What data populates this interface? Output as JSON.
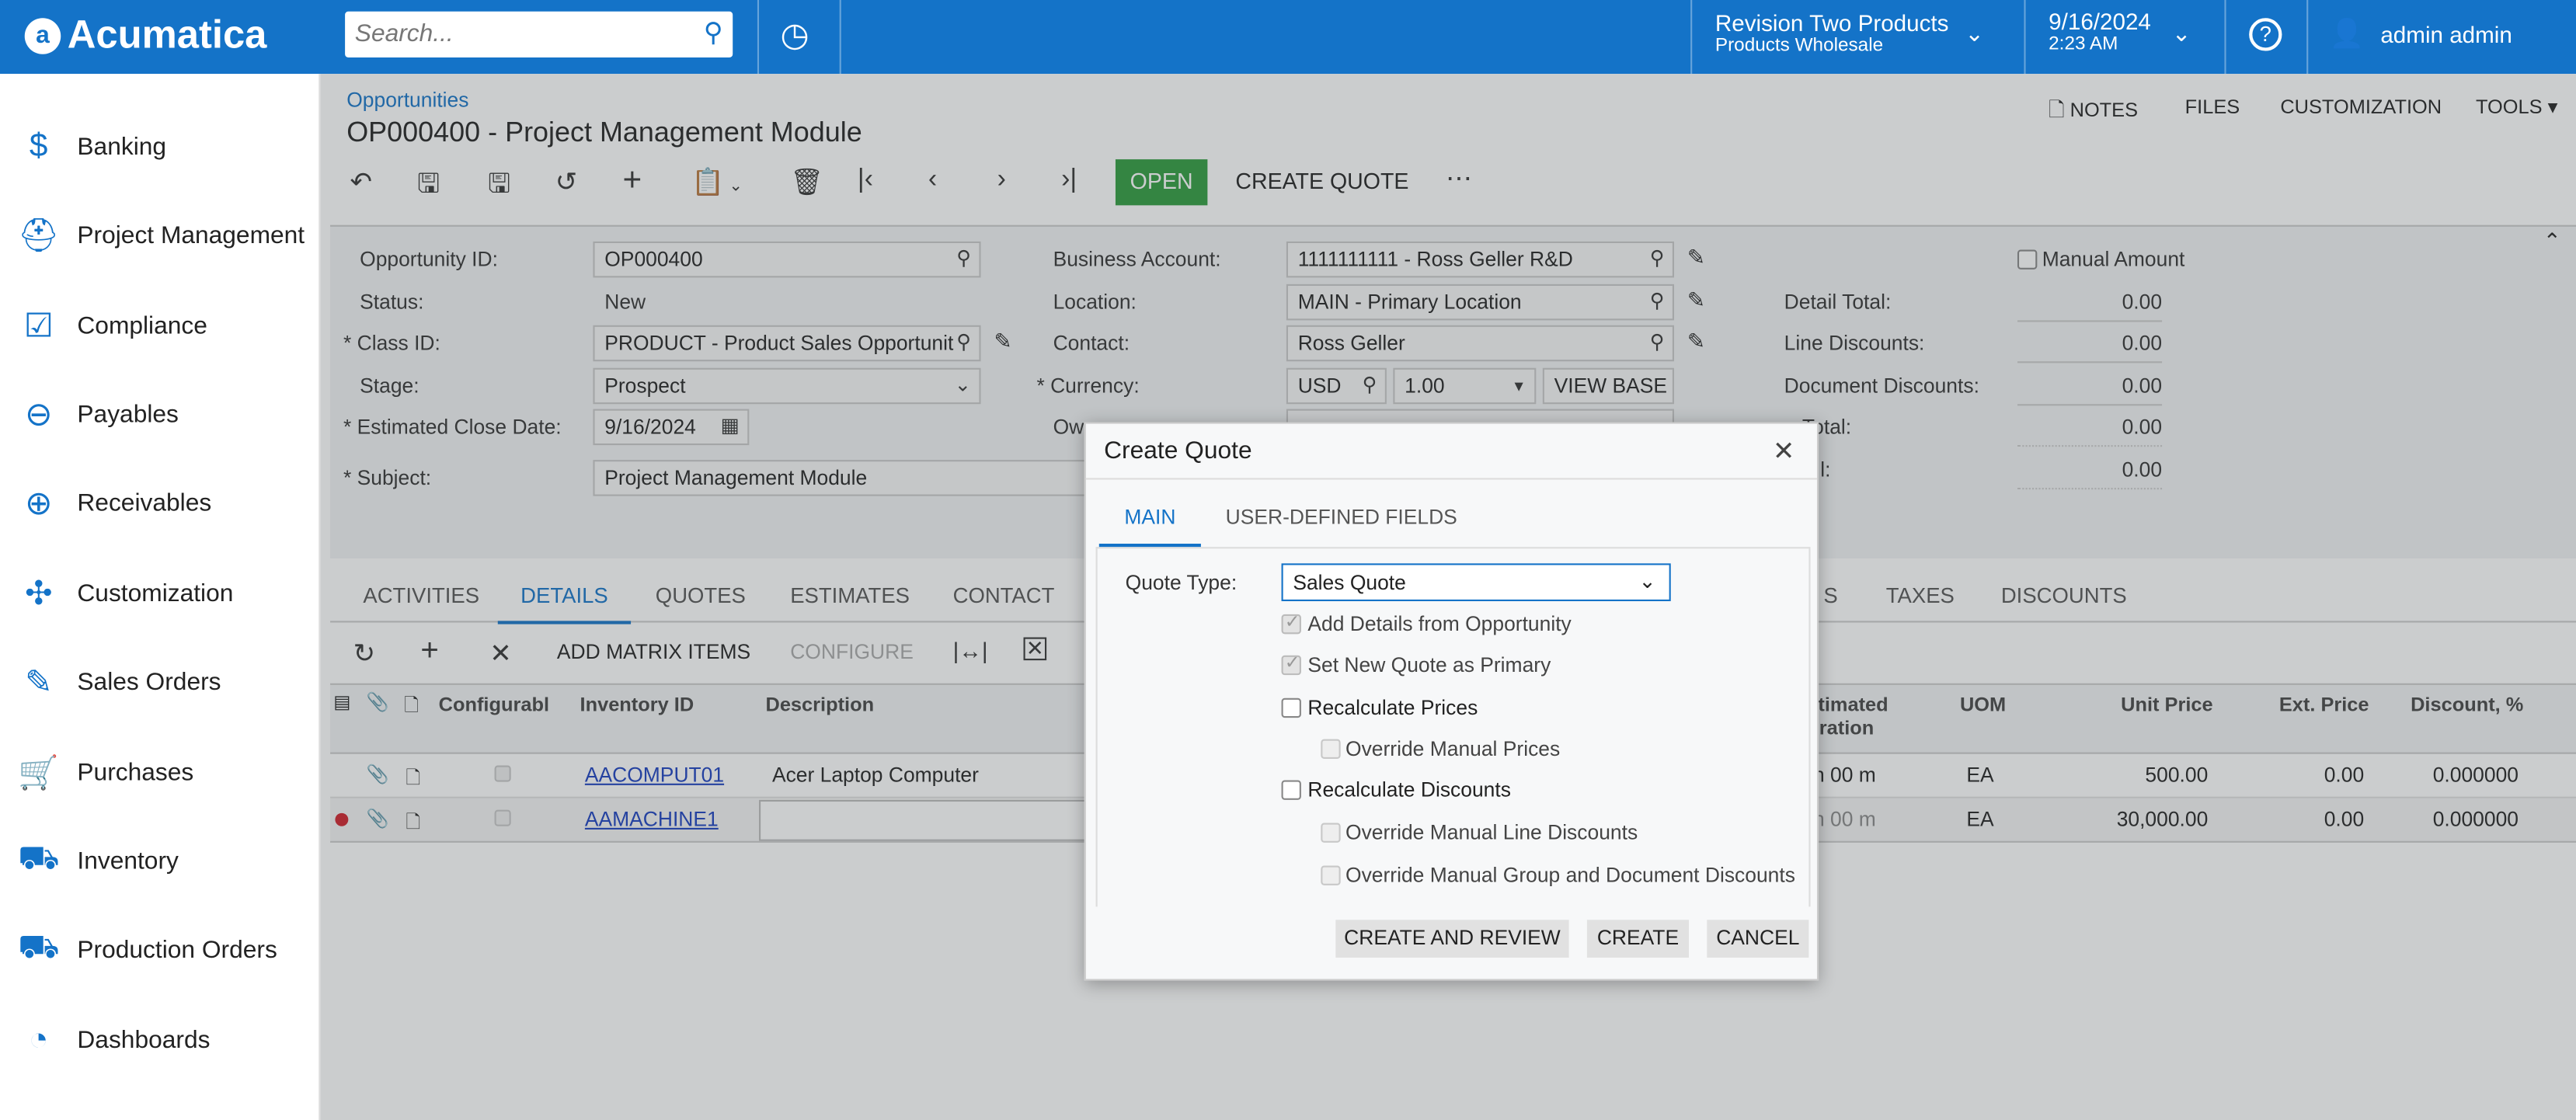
{
  "app": {
    "logo": "Acumatica",
    "search_placeholder": "Search...",
    "company": "Revision Two Products",
    "branch": "Products Wholesale",
    "date": "9/16/2024",
    "time": "2:23 AM",
    "user": "admin admin",
    "brand_color": "#1473c8"
  },
  "sidebar": {
    "items": [
      {
        "label": "Banking",
        "icon": "dollar-icon"
      },
      {
        "label": "Project Management",
        "icon": "worker-icon"
      },
      {
        "label": "Compliance",
        "icon": "checklist-icon"
      },
      {
        "label": "Payables",
        "icon": "minus-circle-icon"
      },
      {
        "label": "Receivables",
        "icon": "plus-circle-icon"
      },
      {
        "label": "Customization",
        "icon": "puzzle-icon"
      },
      {
        "label": "Sales Orders",
        "icon": "edit-icon"
      },
      {
        "label": "Purchases",
        "icon": "cart-icon"
      },
      {
        "label": "Inventory",
        "icon": "truck-icon"
      },
      {
        "label": "Production Orders",
        "icon": "truck-icon"
      },
      {
        "label": "Dashboards",
        "icon": "gauge-icon"
      }
    ]
  },
  "page": {
    "breadcrumb": "Opportunities",
    "title": "OP000400 - Project Management Module",
    "links": [
      "NOTES",
      "FILES",
      "CUSTOMIZATION",
      "TOOLS"
    ],
    "open_label": "OPEN",
    "create_quote_label": "CREATE QUOTE",
    "status_color": "#2e9b3e"
  },
  "form": {
    "opportunity_id_label": "Opportunity ID:",
    "opportunity_id": "OP000400",
    "status_label": "Status:",
    "status": "New",
    "class_id_label": "Class ID:",
    "class_id": "PRODUCT - Product Sales Opportunit",
    "stage_label": "Stage:",
    "stage": "Prospect",
    "close_date_label": "Estimated Close Date:",
    "close_date": "9/16/2024",
    "subject_label": "Subject:",
    "subject": "Project Management Module",
    "business_account_label": "Business Account:",
    "business_account": "1111111111 - Ross Geller R&D",
    "location_label": "Location:",
    "location": "MAIN - Primary Location",
    "contact_label": "Contact:",
    "contact": "Ross Geller",
    "currency_label": "Currency:",
    "currency": "USD",
    "rate": "1.00",
    "view_base": "VIEW BASE",
    "owner_label": "Ow",
    "manual_amount_label": "Manual Amount",
    "detail_total_label": "Detail Total:",
    "detail_total": "0.00",
    "line_discounts_label": "Line Discounts:",
    "line_discounts": "0.00",
    "document_discounts_label": "Document Discounts:",
    "document_discounts": "0.00",
    "tax_total_label": "Total:",
    "tax_total": "0.00",
    "amount_label": "l:",
    "amount": "0.00"
  },
  "tabs": [
    "ACTIVITIES",
    "DETAILS",
    "QUOTES",
    "ESTIMATES",
    "CONTACT",
    "S",
    "TAXES",
    "DISCOUNTS"
  ],
  "grid": {
    "toolbar": {
      "add_matrix": "ADD MATRIX ITEMS",
      "configure": "CONFIGURE"
    },
    "headers": [
      "Configurabl",
      "Inventory ID",
      "Description",
      "stimated",
      "uration",
      "UOM",
      "Unit Price",
      "Ext. Price",
      "Discount, %"
    ],
    "rows": [
      {
        "inventory_id": "AACOMPUT01",
        "description": "Acer Laptop Computer",
        "duration": ") h 00 m",
        "uom": "EA",
        "unit_price": "500.00",
        "ext_price": "0.00",
        "discount": "0.000000"
      },
      {
        "inventory_id": "AAMACHINE1",
        "description": "",
        "duration": ") h 00 m",
        "uom": "EA",
        "unit_price": "30,000.00",
        "ext_price": "0.00",
        "discount": "0.000000"
      }
    ]
  },
  "dialog": {
    "title": "Create Quote",
    "tabs": [
      "MAIN",
      "USER-DEFINED FIELDS"
    ],
    "quote_type_label": "Quote Type:",
    "quote_type": "Sales Quote",
    "options": [
      {
        "label": "Add Details from Opportunity",
        "checked": true,
        "disabled": true
      },
      {
        "label": "Set New Quote as Primary",
        "checked": true,
        "disabled": true
      },
      {
        "label": "Recalculate Prices",
        "checked": false,
        "disabled": false
      },
      {
        "label": "Override Manual Prices",
        "checked": false,
        "disabled": true
      },
      {
        "label": "Recalculate Discounts",
        "checked": false,
        "disabled": false
      },
      {
        "label": "Override Manual Line Discounts",
        "checked": false,
        "disabled": true
      },
      {
        "label": "Override Manual Group and Document Discounts",
        "checked": false,
        "disabled": true
      }
    ],
    "buttons": [
      "CREATE AND REVIEW",
      "CREATE",
      "CANCEL"
    ]
  }
}
